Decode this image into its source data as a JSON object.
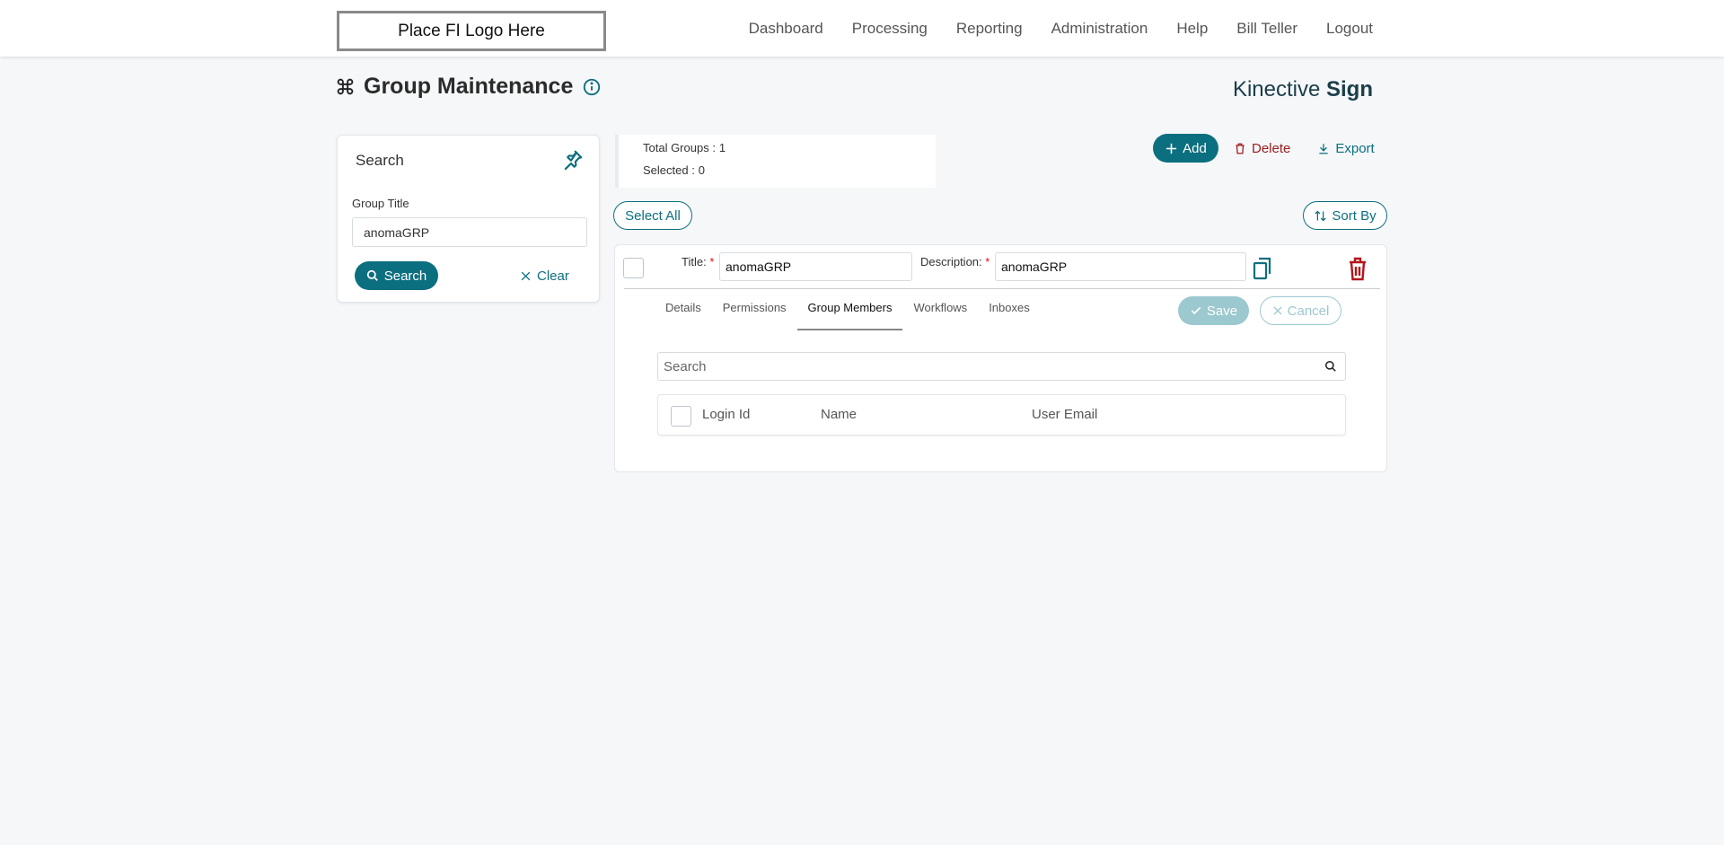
{
  "header": {
    "logo_text": "Place FI Logo Here",
    "nav": [
      "Dashboard",
      "Processing",
      "Reporting",
      "Administration",
      "Help",
      "Bill Teller",
      "Logout"
    ]
  },
  "page": {
    "title": "Group Maintenance",
    "brand_light": "Kinective",
    "brand_bold": "Sign"
  },
  "search_panel": {
    "title": "Search",
    "field_label": "Group Title",
    "field_value": "anomaGRP",
    "search_label": "Search",
    "clear_label": "Clear"
  },
  "summary": {
    "total_label": "Total Groups :",
    "total_value": "1",
    "selected_label": "Selected :",
    "selected_value": "0"
  },
  "toolbar": {
    "add_label": "Add",
    "delete_label": "Delete",
    "export_label": "Export",
    "select_all_label": "Select All",
    "sort_label": "Sort By"
  },
  "group_card": {
    "title_label": "Title:",
    "title_value": "anomaGRP",
    "description_label": "Description:",
    "description_value": "anomaGRP",
    "required_mark": "*",
    "tabs": [
      "Details",
      "Permissions",
      "Group Members",
      "Workflows",
      "Inboxes"
    ],
    "active_tab": "Group Members",
    "save_label": "Save",
    "cancel_label": "Cancel",
    "member_search_placeholder": "Search",
    "columns": [
      "Login Id",
      "Name",
      "User Email"
    ]
  },
  "colors": {
    "primary": "#0c6f7f",
    "danger": "#9b1b1b",
    "disabled": "#9cc8cf"
  }
}
